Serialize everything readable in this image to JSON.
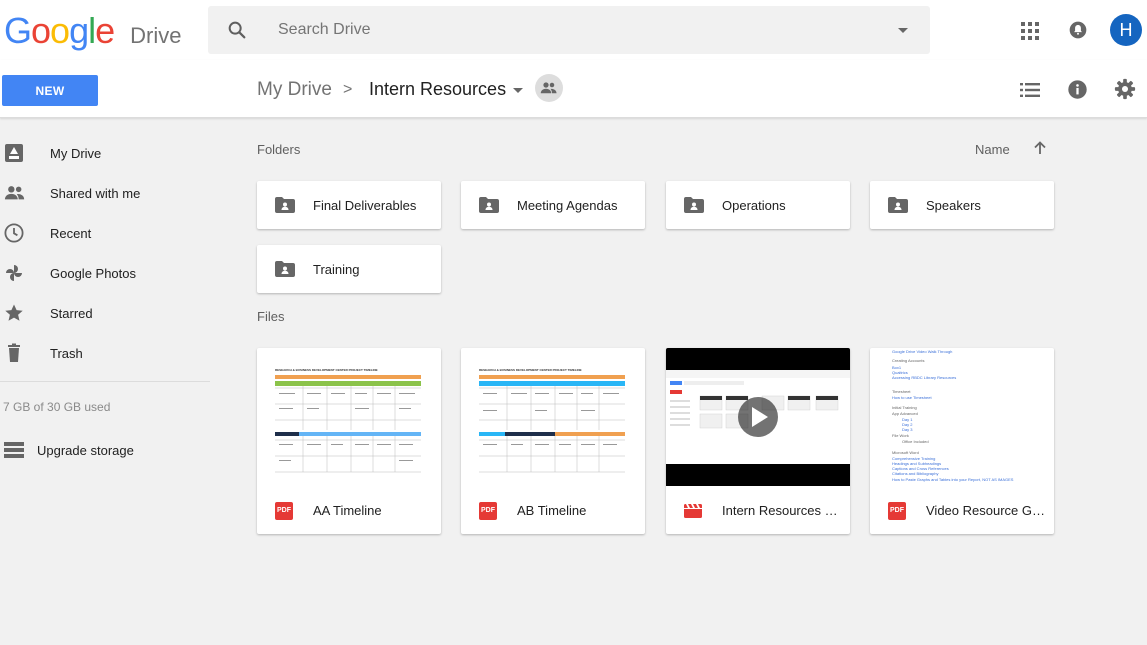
{
  "app": {
    "logo_text": "Google",
    "product_name": "Drive",
    "user_initial": "H"
  },
  "search": {
    "placeholder": "Search Drive",
    "value": ""
  },
  "toolbar": {
    "new_label": "NEW",
    "breadcrumb_root": "My Drive",
    "breadcrumb_separator": ">",
    "breadcrumb_current": "Intern Resources"
  },
  "sidebar": {
    "items": [
      {
        "label": "My Drive",
        "icon": "drive-icon"
      },
      {
        "label": "Shared with me",
        "icon": "people-icon"
      },
      {
        "label": "Recent",
        "icon": "clock-icon"
      },
      {
        "label": "Google Photos",
        "icon": "pinwheel-icon"
      },
      {
        "label": "Starred",
        "icon": "star-icon"
      },
      {
        "label": "Trash",
        "icon": "trash-icon"
      }
    ],
    "storage_text": "7 GB of 30 GB used",
    "upgrade_label": "Upgrade storage"
  },
  "main": {
    "folders_label": "Folders",
    "files_label": "Files",
    "sort_label": "Name",
    "folders": [
      {
        "name": "Final Deliverables"
      },
      {
        "name": "Meeting Agendas"
      },
      {
        "name": "Operations"
      },
      {
        "name": "Speakers"
      },
      {
        "name": "Training"
      }
    ],
    "files": [
      {
        "name": "AA Timeline",
        "type": "pdf",
        "type_badge": "PDF",
        "thumb_title": "RESEARCH & BUSINESS DEVELOPMENT CENTER PROJECT TIMELINE"
      },
      {
        "name": "AB Timeline",
        "type": "pdf",
        "type_badge": "PDF",
        "thumb_title": "RESEARCH & BUSINESS DEVELOPMENT CENTER PROJECT TIMELINE"
      },
      {
        "name": "Intern Resources Video",
        "type": "video"
      },
      {
        "name": "Video Resource Guide",
        "type": "pdf",
        "type_badge": "PDF",
        "thumb_lines": [
          "Google Drive Video Walk Through",
          "Creating Accounts",
          "Box1",
          "Qualtrics",
          "Accessing RBDC Library Resources",
          "Timesheet",
          "How to use Timesheet",
          "Initial Training",
          "App Advanced",
          "Day 1",
          "Day 2",
          "Day 3",
          "File Work",
          "Office Included",
          "Microsoft Word",
          "Comprehensive Training",
          "Headings and Subheadings",
          "Captions and Cross References",
          "Citations and Bibliography",
          "How to Paste Graphs and Tables into your Report, NOT AS IMAGES"
        ]
      }
    ]
  },
  "colors": {
    "accent": "#4285f4",
    "avatar": "#1565c0",
    "pdf_red": "#e53935",
    "logo_blue": "#4285f4",
    "logo_red": "#ea4335",
    "logo_yellow": "#fbbc05",
    "logo_green": "#34a853"
  }
}
